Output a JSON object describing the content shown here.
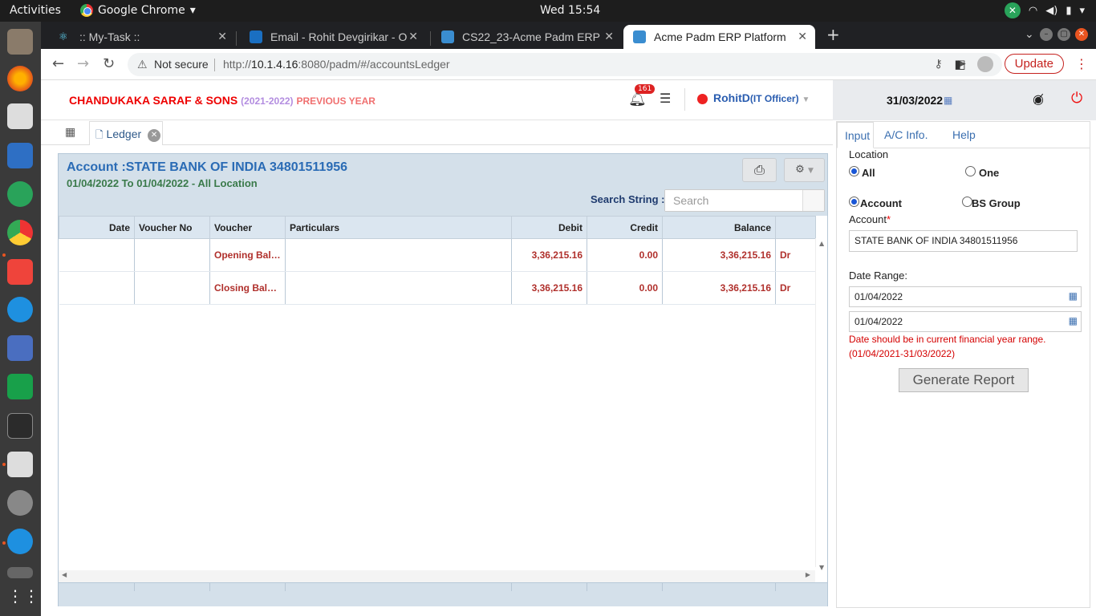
{
  "system": {
    "activities": "Activities",
    "app_name": "Google Chrome",
    "clock": "Wed 15:54"
  },
  "browser": {
    "tabs": [
      {
        "title": ":: My-Task ::"
      },
      {
        "title": "Email - Rohit Devgirikar - O"
      },
      {
        "title": "CS22_23-Acme Padm ERP"
      },
      {
        "title": "Acme Padm ERP Platform"
      }
    ],
    "security": "Not secure",
    "url_host": "10.1.4.16",
    "url_prefix": "http://",
    "url_rest": ":8080/padm/#/accountsLedger",
    "update_label": "Update"
  },
  "header": {
    "company": "CHANDUKAKA SARAF & SONS",
    "year": "(2021-2022)",
    "prev": "PREVIOUS YEAR",
    "notifications": "161",
    "user": "RohitD",
    "role": "(IT Officer)",
    "date": "31/03/2022"
  },
  "workspace": {
    "tab_label": "Ledger"
  },
  "ledger": {
    "title": "Account :STATE BANK OF INDIA 34801511956",
    "subtitle": "01/04/2022 To 01/04/2022 - All Location",
    "search_label": "Search String :",
    "search_placeholder": "Search",
    "columns": [
      "Date",
      "Voucher No",
      "Voucher",
      "Particulars",
      "Debit",
      "Credit",
      "Balance",
      ""
    ],
    "rows": [
      {
        "date": "",
        "voucher_no": "",
        "voucher": "Opening Balance",
        "particulars": "",
        "debit": "3,36,215.16",
        "credit": "0.00",
        "balance": "3,36,215.16",
        "drcr": "Dr"
      },
      {
        "date": "",
        "voucher_no": "",
        "voucher": "Closing Balance",
        "particulars": "",
        "debit": "3,36,215.16",
        "credit": "0.00",
        "balance": "3,36,215.16",
        "drcr": "Dr"
      }
    ]
  },
  "panel": {
    "tabs": [
      "Input",
      "A/C Info.",
      "Help"
    ],
    "location_label": "Location",
    "loc_all": "All",
    "loc_one": "One",
    "type_account": "Account",
    "type_bs": "BS Group",
    "account_label": "Account",
    "account_value": "STATE BANK OF INDIA 34801511956",
    "date_range_label": "Date Range:",
    "date_from": "01/04/2022",
    "date_to": "01/04/2022",
    "date_error": "Date should be in current financial year range. (01/04/2021-31/03/2022)",
    "generate_label": "Generate Report"
  },
  "colors": {
    "accent": "#2a6bb5",
    "danger": "#e00000",
    "ledger_value": "#b0302c"
  }
}
